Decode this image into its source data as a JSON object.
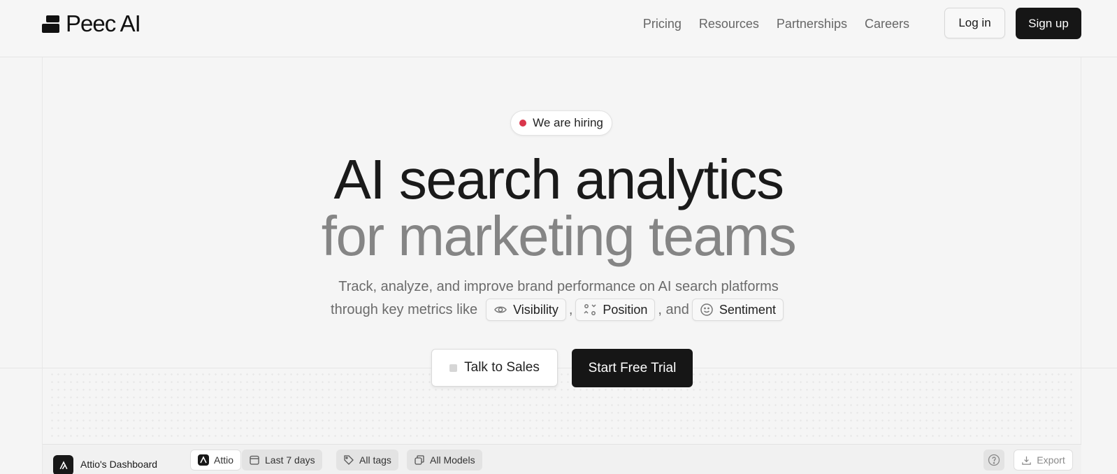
{
  "header": {
    "logo_text": "Peec AI",
    "nav": [
      "Pricing",
      "Resources",
      "Partnerships",
      "Careers"
    ],
    "login_label": "Log in",
    "signup_label": "Sign up"
  },
  "hero": {
    "badge": "We are hiring",
    "title_line1": "AI search analytics",
    "title_line2": "for marketing teams",
    "subtitle_line1": "Track, analyze, and improve brand performance on AI search platforms",
    "subtitle_prefix": "through key metrics like",
    "metric_visibility": "Visibility",
    "metric_position": "Position",
    "metric_sentiment": "Sentiment",
    "comma": ",",
    "and_text": ", and",
    "talk_to_sales": "Talk to Sales",
    "start_trial": "Start Free Trial"
  },
  "dashboard": {
    "title": "Attio's Dashboard",
    "workspace": "Attio",
    "date_range": "Last 7 days",
    "tags": "All tags",
    "models": "All Models",
    "export_label": "Export"
  },
  "colors": {
    "background": "#f5f5f5",
    "primary_button": "#161616",
    "hiring_dot": "#d9364b",
    "title_dark": "#1a1a1a",
    "title_muted": "#858585"
  }
}
